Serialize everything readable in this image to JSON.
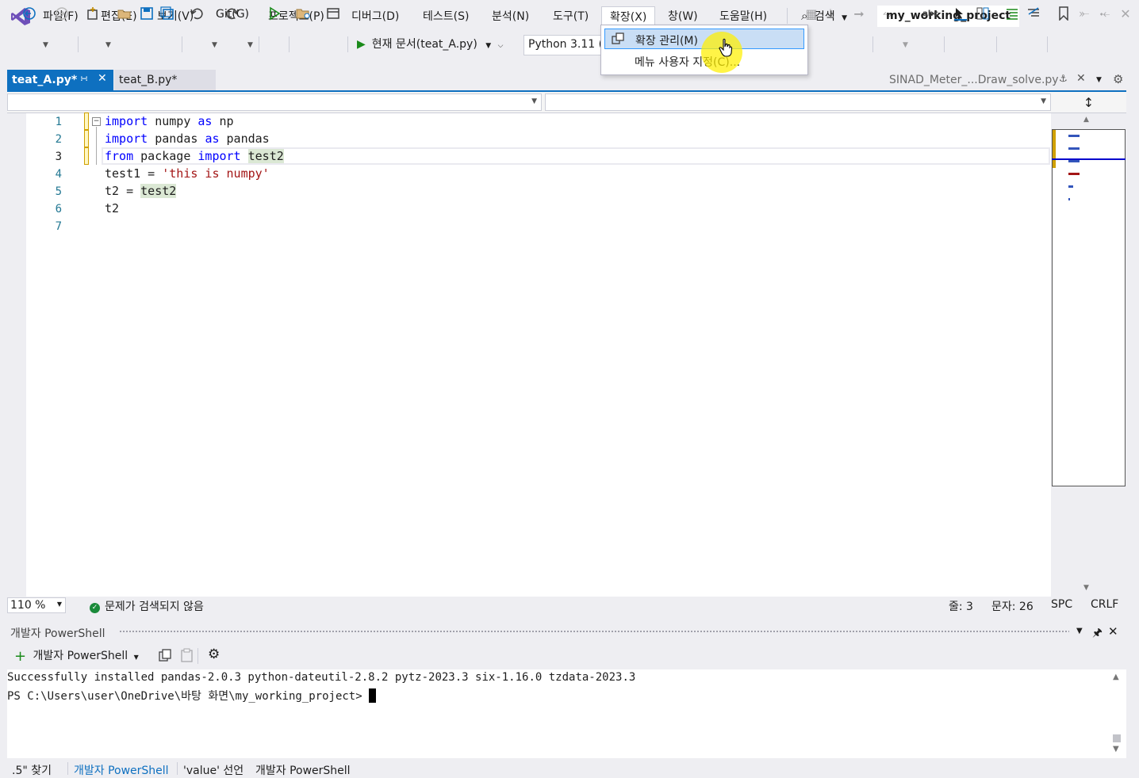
{
  "menubar": {
    "items": [
      "파일(F)",
      "편집(E)",
      "보기(V)",
      "Git(G)",
      "프로젝트(P)",
      "디버그(D)",
      "테스트(S)",
      "분석(N)",
      "도구(T)",
      "확장(X)",
      "창(W)",
      "도움말(H)"
    ],
    "search_label": "검색",
    "project_name": "my_working_project"
  },
  "toolbar": {
    "run_target": "현재 문서(teat_A.py)",
    "environment": "Python 3.11 ("
  },
  "extensions_menu": {
    "items": [
      "확장 관리(M)",
      "메뉴 사용자 지정(C)..."
    ]
  },
  "tabs": {
    "active": "teat_A.py*",
    "second": "teat_B.py*",
    "preview": "SINAD_Meter_...Draw_solve.py"
  },
  "editor": {
    "line_numbers": [
      "1",
      "2",
      "3",
      "4",
      "5",
      "6",
      "7"
    ],
    "code": {
      "l1_kw": "import",
      "l1_rest": " numpy ",
      "l1_as": "as",
      "l1_end": " np",
      "l2_kw": "import",
      "l2_rest": " pandas ",
      "l2_as": "as",
      "l2_end": " pandas",
      "l3_kw": "from",
      "l3_mid": " package ",
      "l3_kw2": "import",
      "l3_sp": " ",
      "l3_end": "test2",
      "l4_pre": "test1 = ",
      "l4_str": "'this is numpy'",
      "l5_pre": "t2 = ",
      "l5_end": "test2",
      "l6": "t2"
    },
    "zoom": "110 %",
    "issues": "문제가 검색되지 않음",
    "line_label": "줄: 3",
    "char_label": "문자: 26",
    "indent": "SPC",
    "eol": "CRLF"
  },
  "terminal": {
    "panel_title": "개발자 PowerShell",
    "new_button": "개발자 PowerShell",
    "lines": [
      "Successfully installed pandas-2.0.3 python-dateutil-2.8.2 pytz-2023.3 six-1.16.0 tzdata-2023.3",
      "PS C:\\Users\\user\\OneDrive\\바탕 화면\\my_working_project> "
    ]
  },
  "bottom_tabs": [
    ".5\" 찾기",
    "개발자 PowerShell",
    "'value' 선언",
    "개발자 PowerShell"
  ],
  "colors": {
    "accent": "#0e70c0",
    "keyword": "#0000ff",
    "string": "#a31515",
    "menu_highlight": "#c9def5"
  }
}
